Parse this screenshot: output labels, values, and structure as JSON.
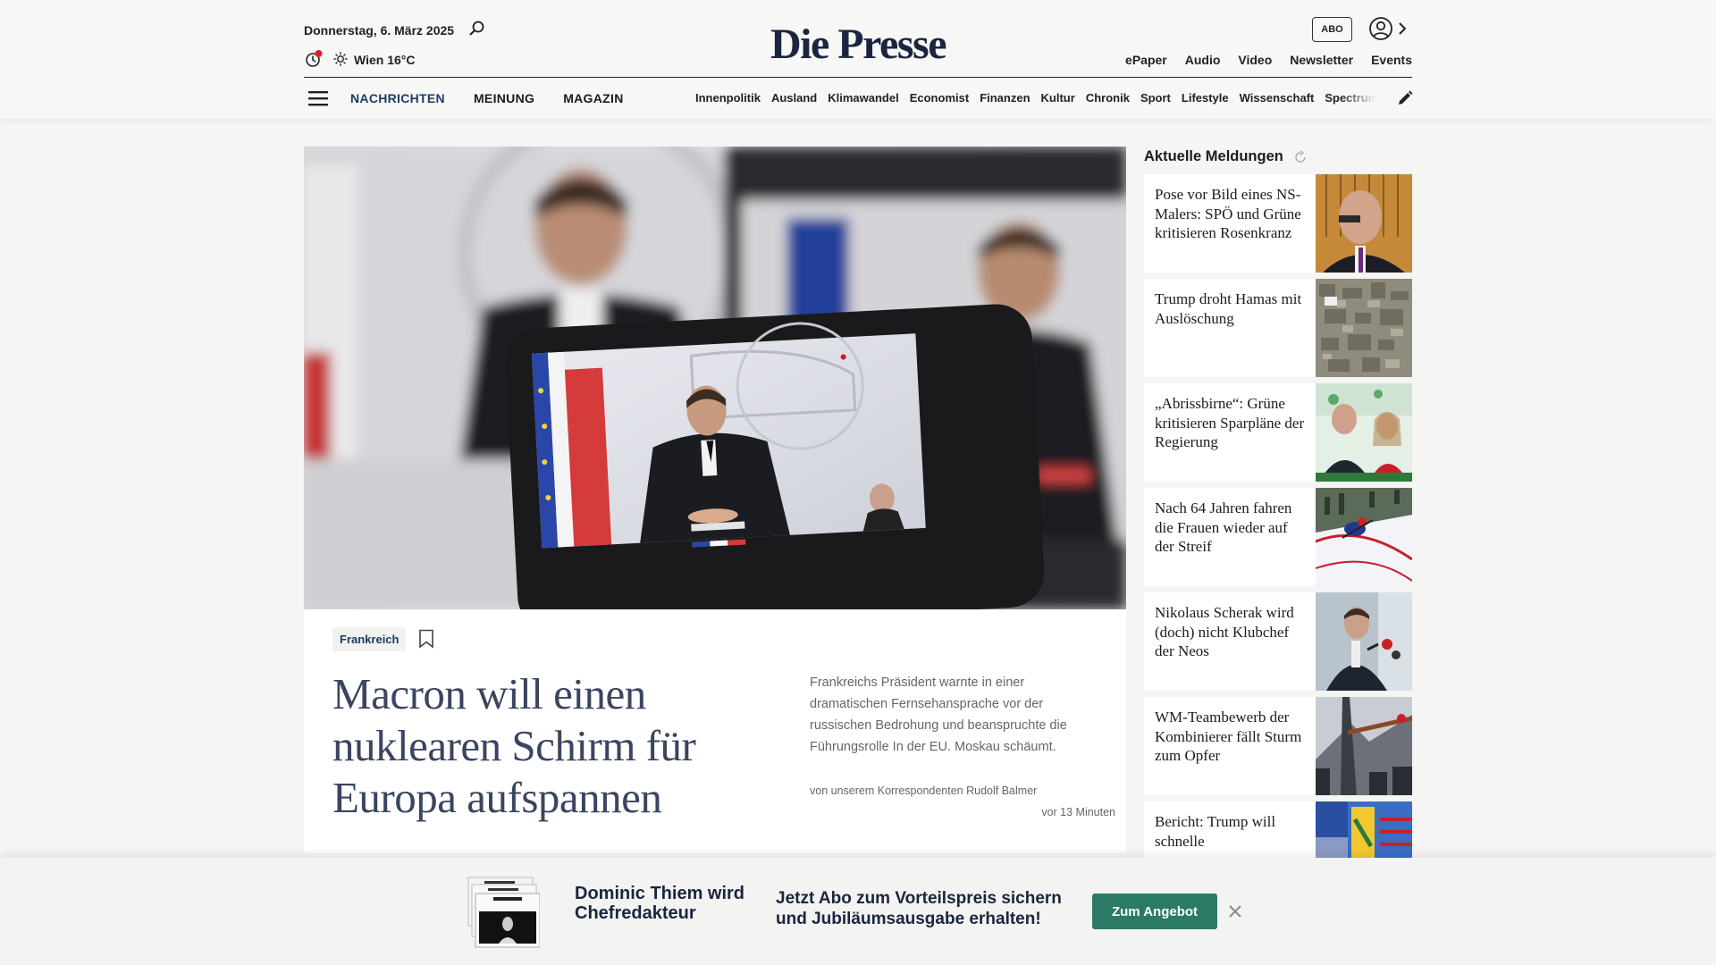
{
  "header": {
    "date": "Donnerstag, 6. März 2025",
    "weather": "Wien 16°C",
    "logo": "Die Presse",
    "abo_label": "ABO",
    "top_links": [
      "ePaper",
      "Audio",
      "Video",
      "Newsletter",
      "Events"
    ],
    "sections": [
      "NACHRICHTEN",
      "MEINUNG",
      "MAGAZIN"
    ],
    "categories": [
      "Innenpolitik",
      "Ausland",
      "Klimawandel",
      "Economist",
      "Finanzen",
      "Kultur",
      "Chronik",
      "Sport",
      "Lifestyle",
      "Wissenschaft",
      "Spectrum"
    ]
  },
  "hero": {
    "tag": "Frankreich",
    "headline": "Macron will einen nuklearen Schirm für Europa aufspannen",
    "teaser": "Frankreichs Präsident warnte in einer dramatischen Fernsehansprache vor der russischen Bedrohung und beanspruchte die Führungsrolle In der EU. Moskau schäumt.",
    "author": "von unserem Korrespondenten Rudolf Balmer",
    "time": "vor 13 Minuten"
  },
  "sidebar": {
    "title": "Aktuelle Meldungen",
    "items": [
      {
        "title": "Pose vor Bild eines NS-Malers: SPÖ und Grüne kritisieren Rosenkranz"
      },
      {
        "title": "Trump droht Hamas mit Auslöschung"
      },
      {
        "title": "„Abrissbirne“: Grüne kritisieren Sparpläne der Regierung"
      },
      {
        "title": "Nach 64 Jahren fahren die Frauen wieder auf der Streif"
      },
      {
        "title": "Nikolaus Scherak wird (doch) nicht Klubchef der Neos"
      },
      {
        "title": "WM-Teambewerb der Kombinierer fällt Sturm zum Opfer"
      },
      {
        "title": "Bericht: Trump will schnelle"
      }
    ]
  },
  "promo": {
    "headline": "Dominic Thiem wird Chefredakteur",
    "text": "Jetzt Abo zum Vorteilspreis sichern und Jubiläumsausgabe erhalten!",
    "button": "Zum Angebot"
  },
  "colors": {
    "brand_navy": "#1b2540",
    "accent_blue": "#1e3b66",
    "cta_green": "#2a7a66",
    "notification_red": "#e0202a"
  }
}
